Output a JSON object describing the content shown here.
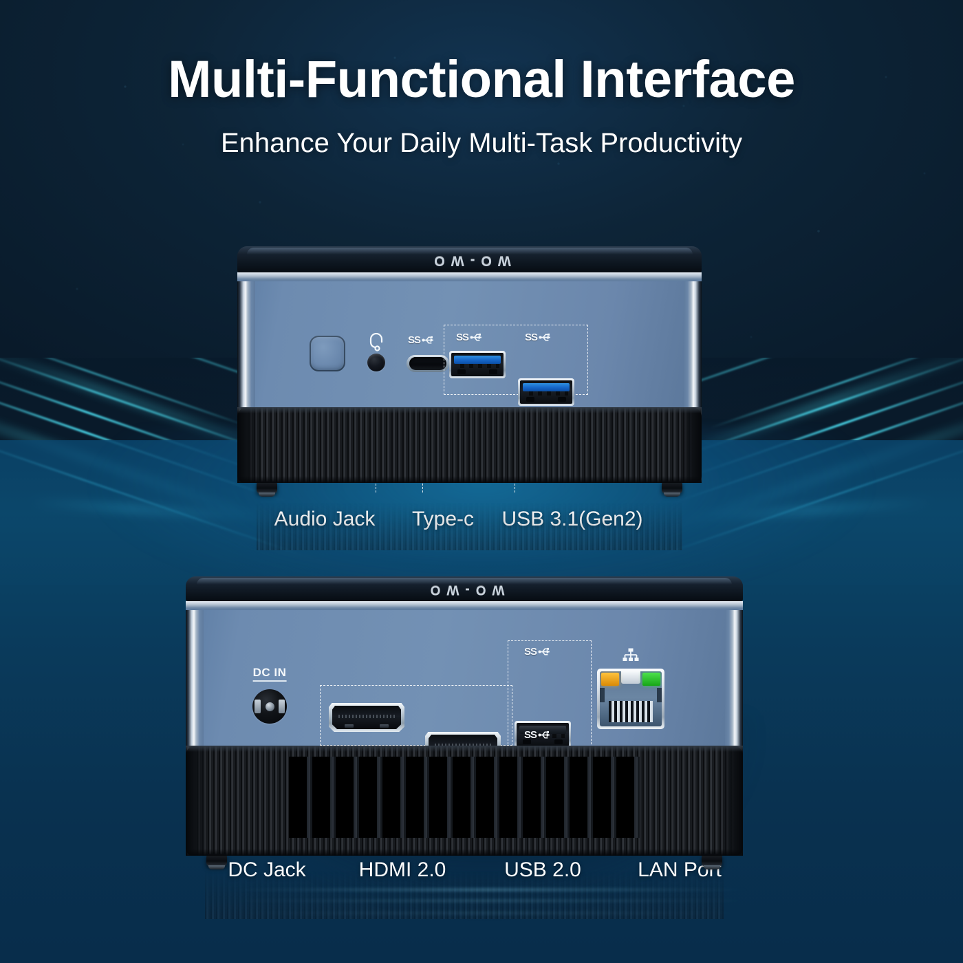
{
  "header": {
    "title": "Multi-Functional Interface",
    "subtitle": "Enhance Your Daily Multi-Task Productivity"
  },
  "brand": {
    "logo_text": "WO-WO"
  },
  "colors": {
    "background_navy": "#0d2235",
    "floor_blue": "#0a5a8c",
    "ray_cyan": "#50ebff",
    "chassis_face": "#6d8bb0",
    "chassis_vent": "#121417",
    "usb3_insert": "#1565c8",
    "usb2_insert": "#1c222a",
    "lan_led_amber": "#ffc23d",
    "lan_led_green": "#4ce04c"
  },
  "front_device": {
    "name": "mini-pc-front-panel",
    "ports": [
      {
        "id": "power-button",
        "type": "button",
        "label": ""
      },
      {
        "id": "audio-jack",
        "type": "audio",
        "label": "",
        "icon": "headphone-icon"
      },
      {
        "id": "type-c",
        "type": "usb-c",
        "label": "",
        "icon": "superspeed-icon"
      },
      {
        "id": "usb31-left",
        "type": "usb-a",
        "label": "",
        "icon": "superspeed-icon"
      },
      {
        "id": "usb31-right",
        "type": "usb-a",
        "label": "",
        "icon": "superspeed-icon"
      }
    ],
    "callouts": [
      {
        "label": "Audio Jack"
      },
      {
        "label": "Type-c"
      },
      {
        "label": "USB 3.1(Gen2)"
      }
    ]
  },
  "rear_device": {
    "name": "mini-pc-rear-panel",
    "ports": [
      {
        "id": "dc-in",
        "type": "barrel-jack",
        "label": "DC IN"
      },
      {
        "id": "hdmi-1",
        "type": "hdmi",
        "label": "HDMI"
      },
      {
        "id": "hdmi-2",
        "type": "hdmi",
        "label": "HDMI"
      },
      {
        "id": "usb20-top",
        "type": "usb-a",
        "label": "",
        "icon": "superspeed-icon"
      },
      {
        "id": "usb20-bottom",
        "type": "usb-a",
        "label": "",
        "icon": "superspeed-icon"
      },
      {
        "id": "lan",
        "type": "rj45",
        "label": "",
        "icon": "network-icon"
      }
    ],
    "callouts": [
      {
        "label": "DC Jack"
      },
      {
        "label": "HDMI 2.0"
      },
      {
        "label": "USB 2.0"
      },
      {
        "label": "LAN Port"
      }
    ]
  }
}
